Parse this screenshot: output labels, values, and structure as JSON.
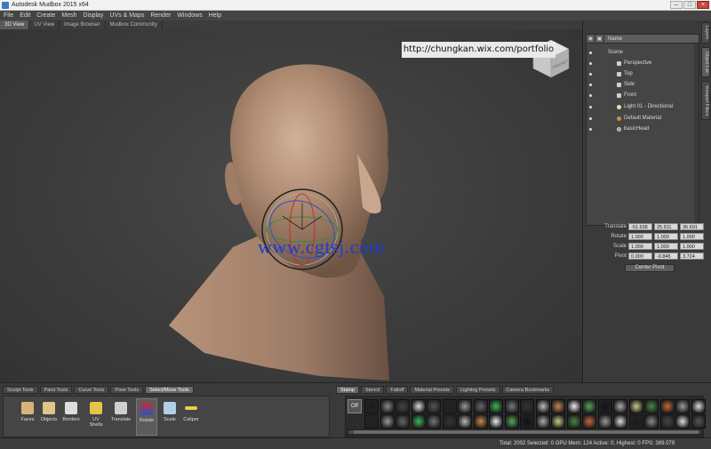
{
  "window": {
    "title": "Autodesk Mudbox 2015 x64"
  },
  "menu": [
    "File",
    "Edit",
    "Create",
    "Mesh",
    "Display",
    "UVs & Maps",
    "Render",
    "Windows",
    "Help"
  ],
  "viewport_tabs": [
    "3D View",
    "UV View",
    "Image Browser",
    "Mudbox Community"
  ],
  "banner": "http://chungkan.wix.com/portfolio",
  "watermark": "www.cgtsj.com",
  "viewcube_label": "FRONT",
  "outliner": {
    "header_name": "Name",
    "items": [
      {
        "label": "Scene",
        "icon": "folder-icon"
      },
      {
        "label": "Perspective",
        "icon": "camera-icon"
      },
      {
        "label": "Top",
        "icon": "camera-icon"
      },
      {
        "label": "Side",
        "icon": "camera-icon"
      },
      {
        "label": "Front",
        "icon": "camera-icon"
      },
      {
        "label": "Light 01 - Directional",
        "icon": "light-icon"
      },
      {
        "label": "Default Material",
        "icon": "material-icon"
      },
      {
        "label": "basicHead",
        "icon": "mesh-icon"
      }
    ]
  },
  "side_tabs": [
    "Layers",
    "Object List",
    "Viewport Filters"
  ],
  "transform": {
    "translate": {
      "label": "Translate",
      "values": [
        "-51.638",
        "25.911",
        "36.691"
      ]
    },
    "rotate": {
      "label": "Rotate",
      "values": [
        "1.000",
        "1.000",
        "1.000"
      ]
    },
    "scale": {
      "label": "Scale",
      "values": [
        "1.000",
        "1.000",
        "1.000"
      ]
    },
    "pivot": {
      "label": "Pivot",
      "values": [
        "0.000",
        "-0.845",
        "3.724"
      ]
    },
    "center_pivot": "Center Pivot"
  },
  "tool_tabs": [
    "Sculpt Tools",
    "Paint Tools",
    "Curve Tools",
    "Pose Tools",
    "Select/Move Tools"
  ],
  "tools": [
    "Faces",
    "Objects",
    "Borders",
    "UV Shells",
    "Translate",
    "Rotate",
    "Scale",
    "Caliper"
  ],
  "tray_tabs": [
    "Stamp",
    "Stencil",
    "Falloff",
    "Material Presets",
    "Lighting Presets",
    "Camera Bookmarks"
  ],
  "stamp_off": "Off",
  "status": "Total: 2002  Selected: 0  GPU Mem: 124  Active: 0, Highest: 0  FPS: 389.079",
  "colors": {
    "accent": "#3a7bbf",
    "skin": "#b08c73",
    "watermark": "#1a3fd0"
  }
}
